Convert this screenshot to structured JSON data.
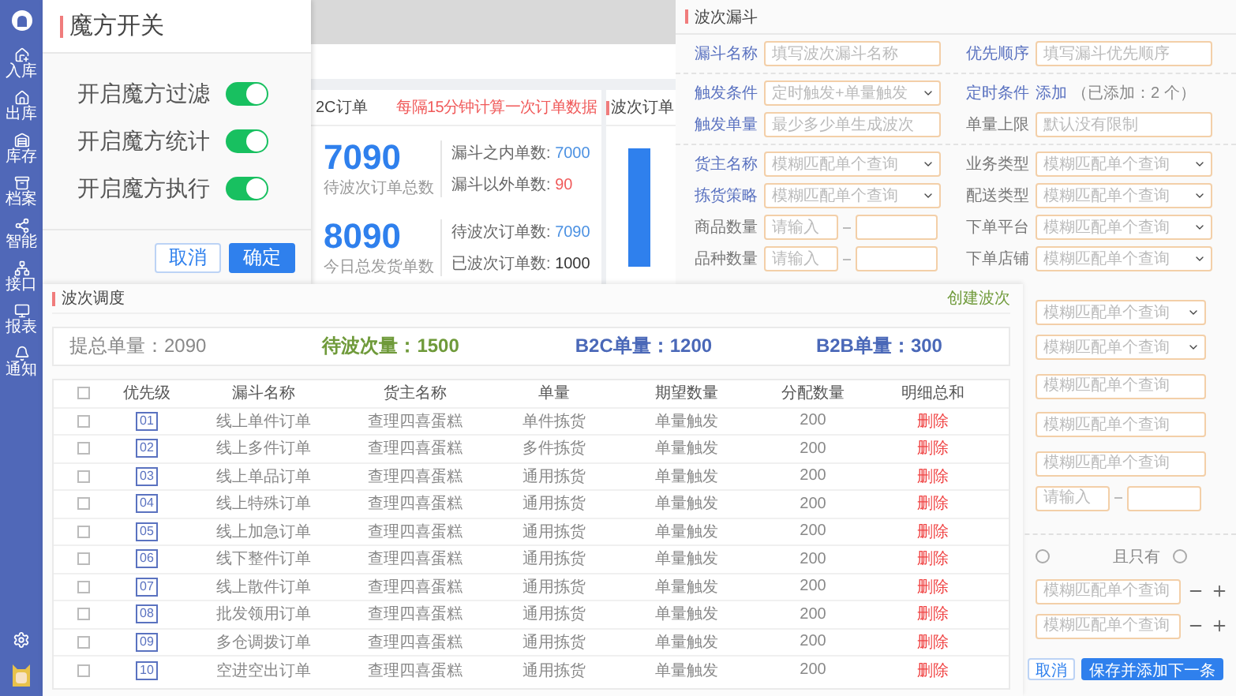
{
  "sidebar": {
    "items": [
      {
        "label": "入库"
      },
      {
        "label": "出库"
      },
      {
        "label": "库存"
      },
      {
        "label": "档案"
      },
      {
        "label": "智能"
      },
      {
        "label": "接口"
      },
      {
        "label": "报表"
      },
      {
        "label": "通知"
      }
    ]
  },
  "dashboard": {
    "stats_card": {
      "title": "2C订单",
      "note": "每隔15分钟计算一次订单数据",
      "stats": [
        {
          "value": "7090",
          "caption": "待波次订单总数",
          "details": [
            {
              "label": "漏斗之内单数:",
              "value": "7000",
              "color": "#4a90e2"
            },
            {
              "label": "漏斗以外单数:",
              "value": "90",
              "color": "#f05a5a"
            }
          ]
        },
        {
          "value": "8090",
          "caption": "今日总发货单数",
          "details": [
            {
              "label": "待波次订单数:",
              "value": "7090",
              "color": "#4a90e2"
            },
            {
              "label": "已波次订单数:",
              "value": "1000",
              "color": "#333333"
            }
          ]
        }
      ]
    },
    "chart_card": {
      "title": "波次订单"
    }
  },
  "magic_panel": {
    "title": "魔方开关",
    "switches": [
      {
        "label": "开启魔方过滤",
        "on": true
      },
      {
        "label": "开启魔方统计",
        "on": true
      },
      {
        "label": "开启魔方执行",
        "on": true
      }
    ],
    "buttons": [
      {
        "label": "取消",
        "kind": "secondary"
      },
      {
        "label": "确定",
        "kind": "primary"
      }
    ]
  },
  "funnel_panel": {
    "title": "波次漏斗",
    "sections": [
      [
        [
          {
            "label": "漏斗名称",
            "required": true,
            "field": {
              "kind": "input",
              "placeholder": "填写波次漏斗名称"
            }
          },
          {
            "label": "优先顺序",
            "required": true,
            "field": {
              "kind": "input",
              "placeholder": "填写漏斗优先顺序"
            }
          }
        ]
      ],
      [
        [
          {
            "label": "触发条件",
            "required": true,
            "field": {
              "kind": "select",
              "placeholder": "定时触发+单量触发"
            }
          },
          {
            "label": "定时条件",
            "required": true,
            "field": {
              "kind": "link",
              "link": "添加",
              "note": "（已添加：2 个）"
            }
          }
        ],
        [
          {
            "label": "触发单量",
            "required": true,
            "field": {
              "kind": "input",
              "placeholder": "最少多少单生成波次"
            }
          },
          {
            "label": "单量上限",
            "required": false,
            "field": {
              "kind": "input",
              "placeholder": "默认没有限制"
            }
          }
        ]
      ],
      [
        [
          {
            "label": "货主名称",
            "required": true,
            "field": {
              "kind": "select",
              "placeholder": "模糊匹配单个查询"
            }
          },
          {
            "label": "业务类型",
            "required": false,
            "field": {
              "kind": "select",
              "placeholder": "模糊匹配单个查询"
            }
          }
        ],
        [
          {
            "label": "拣货策略",
            "required": true,
            "field": {
              "kind": "select",
              "placeholder": "模糊匹配单个查询"
            }
          },
          {
            "label": "配送类型",
            "required": false,
            "field": {
              "kind": "select",
              "placeholder": "模糊匹配单个查询"
            }
          }
        ],
        [
          {
            "label": "商品数量",
            "required": false,
            "field": {
              "kind": "range",
              "placeholder": "请输入"
            }
          },
          {
            "label": "下单平台",
            "required": false,
            "field": {
              "kind": "select",
              "placeholder": "模糊匹配单个查询"
            }
          }
        ],
        [
          {
            "label": "品种数量",
            "required": false,
            "field": {
              "kind": "range",
              "placeholder": "请输入"
            }
          },
          {
            "label": "下单店铺",
            "required": false,
            "field": {
              "kind": "select",
              "placeholder": "模糊匹配单个查询"
            }
          }
        ]
      ]
    ],
    "lower_fields": [
      {
        "kind": "select",
        "placeholder": "模糊匹配单个查询"
      },
      {
        "kind": "select",
        "placeholder": "模糊匹配单个查询"
      },
      {
        "kind": "input",
        "placeholder": "模糊匹配单个查询"
      },
      {
        "kind": "input",
        "placeholder": "模糊匹配单个查询"
      },
      {
        "kind": "input",
        "placeholder": "模糊匹配单个查询"
      },
      {
        "kind": "range",
        "placeholder": "请输入"
      }
    ],
    "match_options": [
      {
        "selected": false
      },
      {
        "label": "且只有",
        "selected": false
      }
    ],
    "stepper_fields": [
      {
        "placeholder": "模糊匹配单个查询"
      },
      {
        "placeholder": "模糊匹配单个查询"
      }
    ],
    "buttons": [
      {
        "label": "取消",
        "kind": "secondary"
      },
      {
        "label": "保存并添加下一条",
        "kind": "primary"
      }
    ]
  },
  "dispatch_panel": {
    "title": "波次调度",
    "action": "创建波次",
    "summary": [
      {
        "text": "提总单量：2090",
        "color": "#888888"
      },
      {
        "text": "待波次量：1500",
        "color": "#6f9a3a"
      },
      {
        "text": "B2C单量：1200",
        "color": "#4a68b8"
      },
      {
        "text": "B2B单量：300",
        "color": "#4a68b8"
      }
    ],
    "table": {
      "header_checked": false,
      "columns": [
        "优先级",
        "漏斗名称",
        "货主名称",
        "单量",
        "期望数量",
        "分配数量",
        "明细总和"
      ],
      "rows": [
        {
          "checked": false,
          "priority": "01",
          "name": "线上单件订单",
          "owner": "查理四喜蛋糕",
          "quantity": "单件拣货",
          "expected": "单量触发",
          "allocated": "200",
          "action": "删除"
        },
        {
          "checked": false,
          "priority": "02",
          "name": "线上多件订单",
          "owner": "查理四喜蛋糕",
          "quantity": "多件拣货",
          "expected": "单量触发",
          "allocated": "200",
          "action": "删除"
        },
        {
          "checked": false,
          "priority": "03",
          "name": "线上单品订单",
          "owner": "查理四喜蛋糕",
          "quantity": "通用拣货",
          "expected": "单量触发",
          "allocated": "200",
          "action": "删除"
        },
        {
          "checked": false,
          "priority": "04",
          "name": "线上特殊订单",
          "owner": "查理四喜蛋糕",
          "quantity": "通用拣货",
          "expected": "单量触发",
          "allocated": "200",
          "action": "删除"
        },
        {
          "checked": false,
          "priority": "05",
          "name": "线上加急订单",
          "owner": "查理四喜蛋糕",
          "quantity": "通用拣货",
          "expected": "单量触发",
          "allocated": "200",
          "action": "删除"
        },
        {
          "checked": false,
          "priority": "06",
          "name": "线下整件订单",
          "owner": "查理四喜蛋糕",
          "quantity": "通用拣货",
          "expected": "单量触发",
          "allocated": "200",
          "action": "删除"
        },
        {
          "checked": false,
          "priority": "07",
          "name": "线上散件订单",
          "owner": "查理四喜蛋糕",
          "quantity": "通用拣货",
          "expected": "单量触发",
          "allocated": "200",
          "action": "删除"
        },
        {
          "checked": false,
          "priority": "08",
          "name": "批发领用订单",
          "owner": "查理四喜蛋糕",
          "quantity": "通用拣货",
          "expected": "单量触发",
          "allocated": "200",
          "action": "删除"
        },
        {
          "checked": false,
          "priority": "09",
          "name": "多仓调拨订单",
          "owner": "查理四喜蛋糕",
          "quantity": "通用拣货",
          "expected": "单量触发",
          "allocated": "200",
          "action": "删除"
        },
        {
          "checked": false,
          "priority": "10",
          "name": "空进空出订单",
          "owner": "查理四喜蛋糕",
          "quantity": "通用拣货",
          "expected": "单量触发",
          "allocated": "200",
          "action": "删除"
        }
      ]
    }
  }
}
